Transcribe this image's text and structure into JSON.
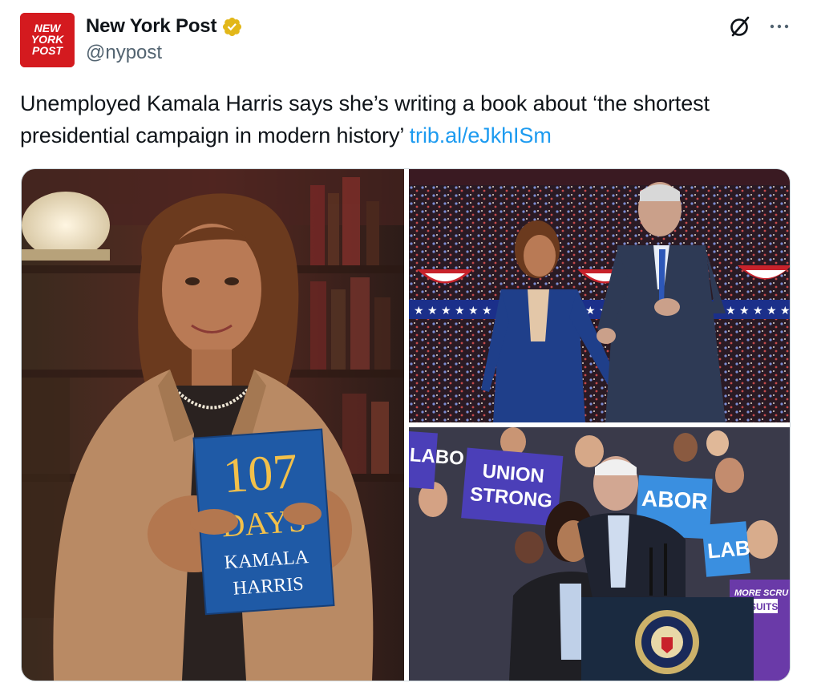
{
  "account": {
    "display_name": "New York Post",
    "handle": "@nypost",
    "avatar_lines": [
      "NEW",
      "YORK",
      "POST"
    ],
    "avatar_color": "#d41a1f",
    "verified_color": "#e2b719"
  },
  "tweet": {
    "text": "Unemployed Kamala Harris says she’s writing a book about ‘the shortest presidential campaign in modern history’ ",
    "link": "trib.al/eJkhISm",
    "link_color": "#1d9bf0"
  },
  "media": {
    "book": {
      "number": "107",
      "word": "DAYS",
      "author_first": "KAMALA",
      "author_last": "HARRIS",
      "cover_color": "#1f5aa6"
    },
    "signs": {
      "union_line1": "UNION",
      "union_line2": "STRONG",
      "labor_left": "LABO",
      "labor_mid": "ABOR",
      "labor_right": "LAB",
      "shirt": "MORE SCRU",
      "shirt2": "SUITS",
      "sign_color": "#4b3fb8"
    }
  },
  "icons": {
    "grok": "grok-icon",
    "more": "more-icon",
    "verified": "verified-badge-icon"
  }
}
